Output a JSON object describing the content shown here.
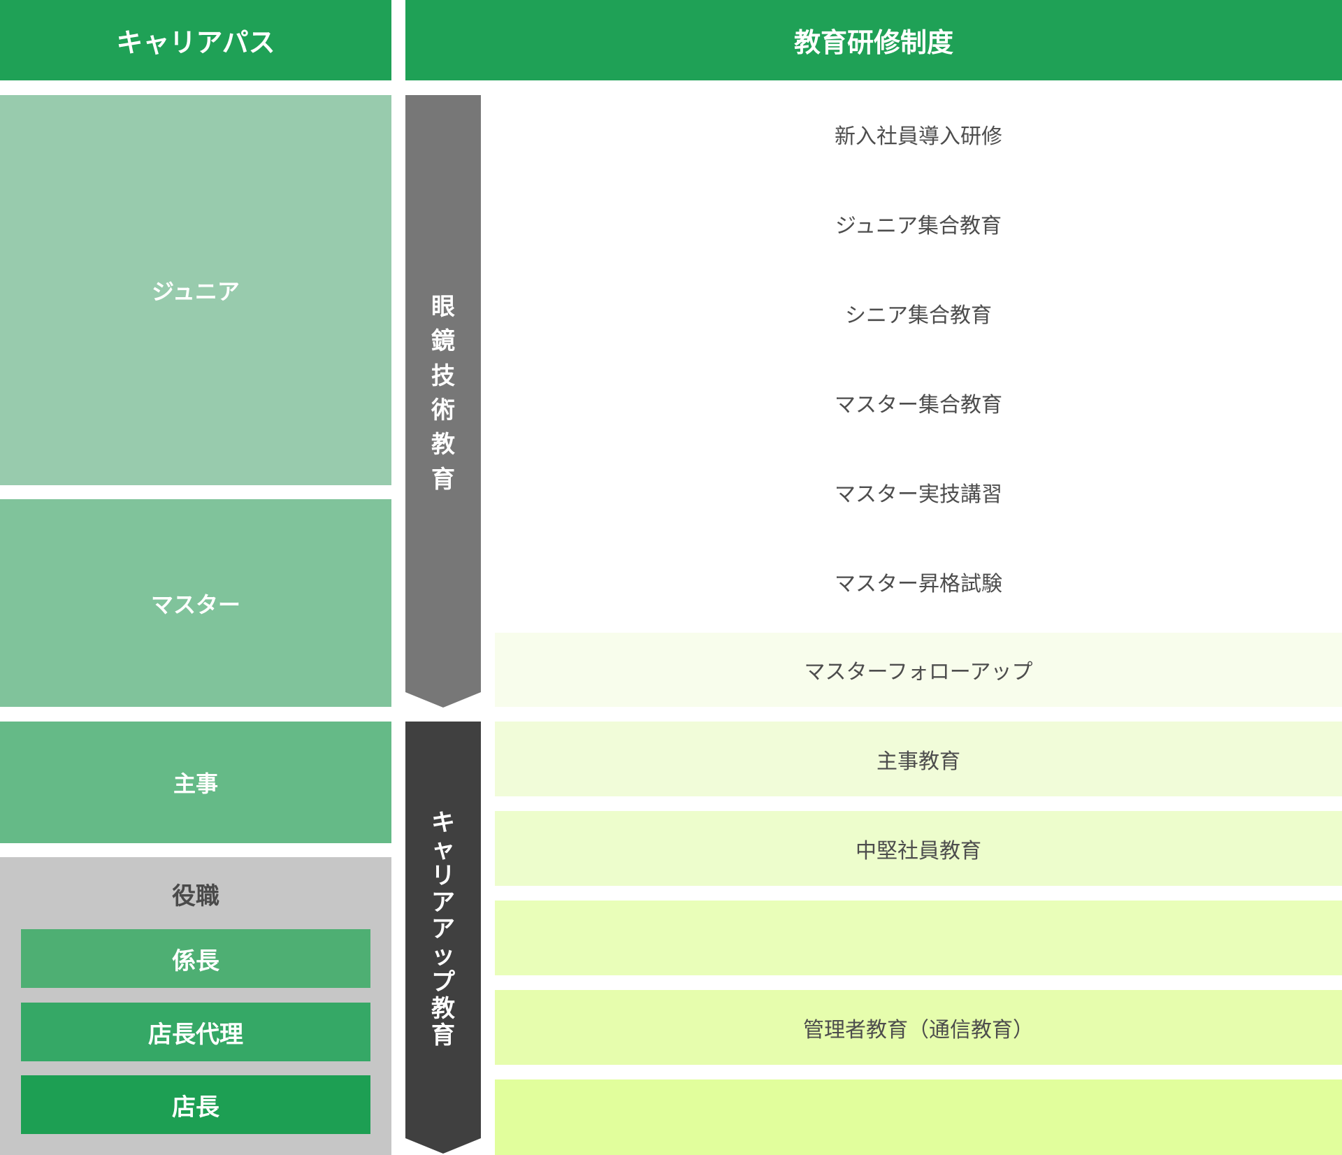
{
  "header": {
    "career_path": "キャリアパス",
    "training_system": "教育研修制度"
  },
  "career_path": {
    "junior": "ジュニア",
    "master": "マスター",
    "shuji": "主事",
    "position": {
      "label": "役職",
      "ranks": [
        "係長",
        "店長代理",
        "店長"
      ]
    }
  },
  "categories": {
    "technical": [
      "眼",
      "鏡",
      "技",
      "術",
      "教",
      "育"
    ],
    "career_up": [
      "キ",
      "ャ",
      "リ",
      "ア",
      "ア",
      "ッ",
      "プ",
      "教",
      "育"
    ]
  },
  "trainings": [
    "新入社員導入研修",
    "ジュニア集合教育",
    "シニア集合教育",
    "マスター集合教育",
    "マスター実技講習",
    "マスター昇格試験",
    "マスターフォローアップ",
    "主事教育",
    "中堅社員教育",
    "",
    "管理者教育（通信教育）",
    ""
  ],
  "colors": {
    "header_green": "#1fa156",
    "junior": "#98cbad",
    "master": "#80c39b",
    "shuji": "#65ba87",
    "position_bg": "#c6c6c6",
    "rank_1": "#4eaf73",
    "rank_2": "#35a866",
    "rank_3": "#1d9f53",
    "technical_arrow": "#777777",
    "career_arrow": "#404040"
  }
}
